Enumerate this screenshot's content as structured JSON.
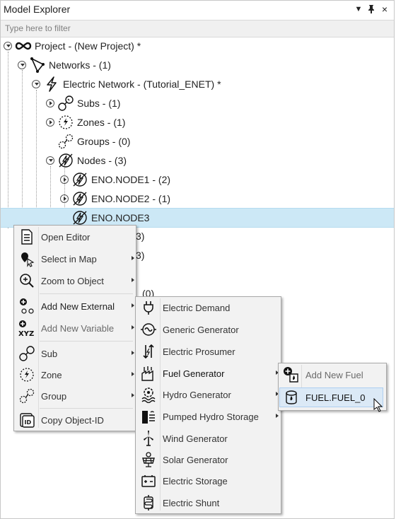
{
  "panel": {
    "title": "Model Explorer",
    "dropdown_icon": "chevron-down-icon",
    "pin_icon": "pin-icon",
    "close_icon": "close-icon"
  },
  "filter": {
    "placeholder": "Type here to filter",
    "value": ""
  },
  "tree": {
    "project": "Project - (New Project) *",
    "networks": "Networks - (1)",
    "electric_network": "Electric Network - (Tutorial_ENET) *",
    "subs": "Subs - (1)",
    "zones": "Zones - (1)",
    "groups": "Groups - (0)",
    "nodes": "Nodes - (3)",
    "node1": "ENO.NODE1 - (2)",
    "node2": "ENO.NODE2 - (1)",
    "node3": "ENO.NODE3",
    "hidden_fragments": [
      "3)",
      "3)",
      "(0)"
    ]
  },
  "context_menu": {
    "items": [
      {
        "label": "Open Editor",
        "icon": "editor-icon"
      },
      {
        "label": "Select in Map",
        "icon": "map-select-icon"
      },
      {
        "label": "Zoom to Object",
        "icon": "zoom-icon"
      },
      {
        "label": "Add New External",
        "icon": "add-external-icon"
      },
      {
        "label": "Add New Variable",
        "icon": "add-variable-icon"
      },
      {
        "label": "Sub",
        "icon": "sub-icon"
      },
      {
        "label": "Zone",
        "icon": "zone-icon"
      },
      {
        "label": "Group",
        "icon": "group-icon"
      },
      {
        "label": "Copy Object-ID",
        "icon": "id-icon"
      }
    ]
  },
  "externals_menu": {
    "items": [
      {
        "label": "Electric Demand",
        "icon": "plug-icon"
      },
      {
        "label": "Generic Generator",
        "icon": "generator-icon"
      },
      {
        "label": "Electric Prosumer",
        "icon": "prosumer-icon"
      },
      {
        "label": "Fuel Generator",
        "icon": "fuel-generator-icon"
      },
      {
        "label": "Hydro Generator",
        "icon": "hydro-icon"
      },
      {
        "label": "Pumped Hydro Storage",
        "icon": "pumped-hydro-icon"
      },
      {
        "label": "Wind Generator",
        "icon": "wind-icon"
      },
      {
        "label": "Solar Generator",
        "icon": "solar-icon"
      },
      {
        "label": "Electric Storage",
        "icon": "battery-icon"
      },
      {
        "label": "Electric Shunt",
        "icon": "shunt-icon"
      }
    ]
  },
  "fuel_menu": {
    "items": [
      {
        "label": "Add New Fuel",
        "icon": "add-fuel-icon"
      },
      {
        "label": "FUEL.FUEL_0",
        "icon": "fuel-icon"
      }
    ]
  },
  "colors": {
    "selection": "#cce8f6",
    "menu_bg": "#f2f2f2",
    "highlight": "#dbe9f6"
  }
}
